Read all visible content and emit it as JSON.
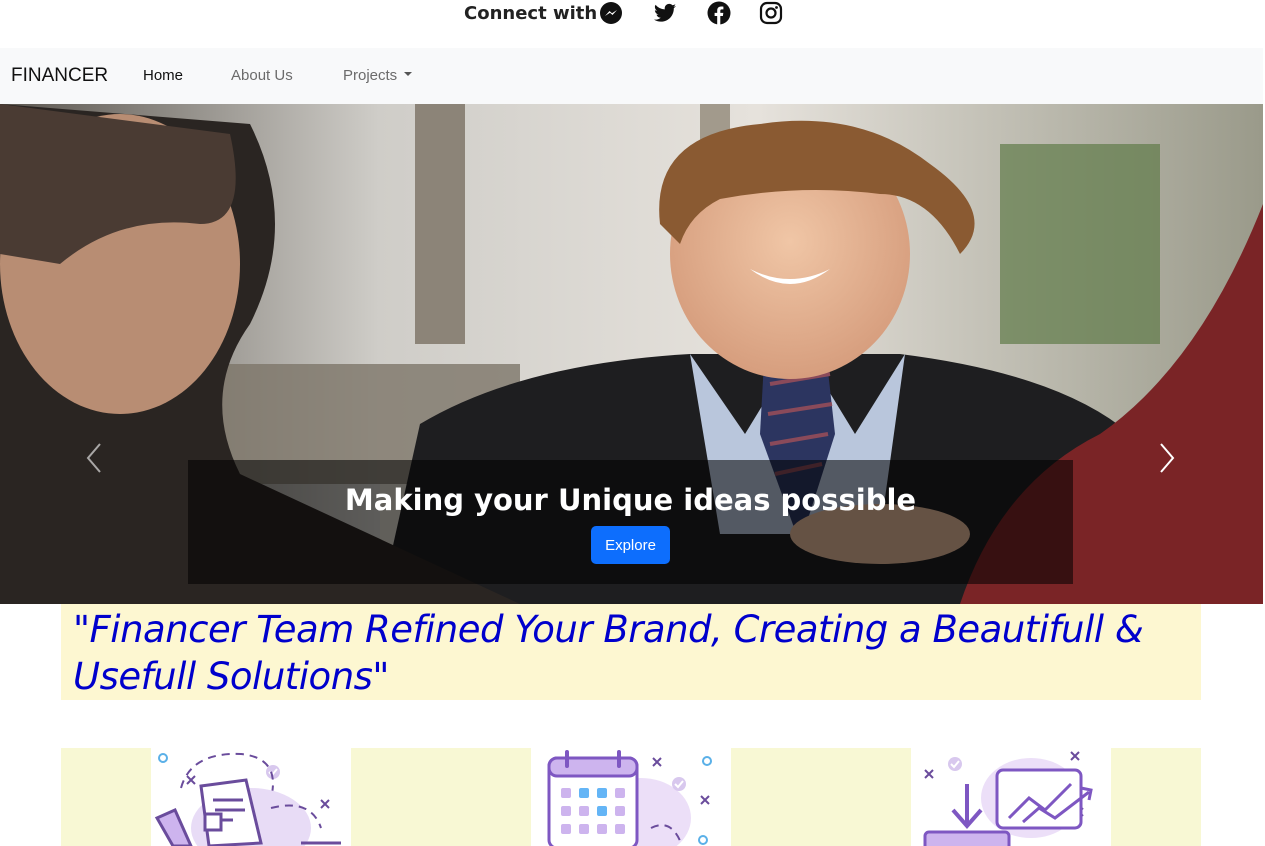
{
  "header": {
    "connect_label": "Connect with",
    "social_icons": [
      "messenger-icon",
      "twitter-icon",
      "facebook-icon",
      "instagram-icon"
    ]
  },
  "navbar": {
    "brand": "FINANCER",
    "links": [
      {
        "label": "Home",
        "active": true
      },
      {
        "label": "About Us",
        "active": false
      },
      {
        "label": "Projects",
        "active": false,
        "dropdown": true
      }
    ]
  },
  "hero": {
    "caption_title": "Making your Unique ideas possible",
    "button_label": "Explore",
    "prev_icon": "chevron-left-icon",
    "next_icon": "chevron-right-icon"
  },
  "quote": {
    "text": "\"Financer Team Refined Your Brand, Creating a Beautifull & Usefull Solutions\""
  },
  "features": {
    "icons": [
      "document-icon",
      "calendar-icon",
      "download-chart-icon"
    ]
  },
  "colors": {
    "accent": "#0d6efd",
    "quote_text": "#0000cc",
    "quote_bg": "#fdf7d1",
    "features_bg": "#f8f8d4",
    "navbar_bg": "#f8f9fa",
    "icon_purple": "#7e57c2"
  }
}
